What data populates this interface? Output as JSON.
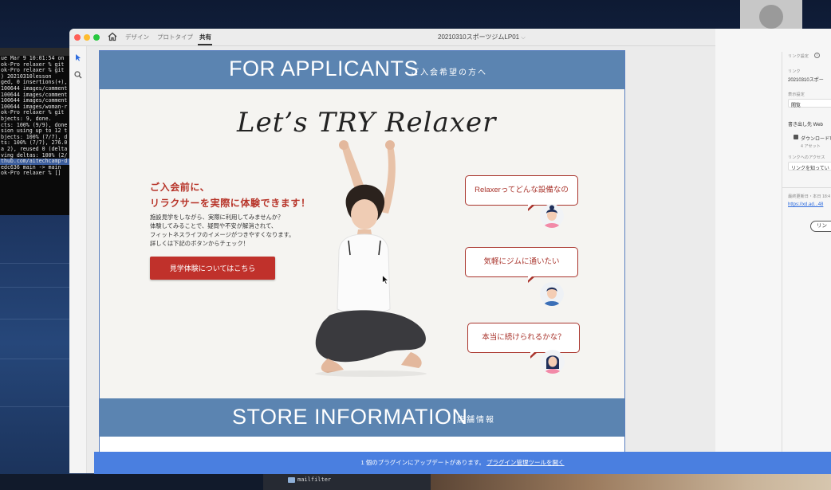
{
  "terminal": {
    "lines": [
      "ue Mar  9 10:01:54 on",
      "ok-Pro relaxer % git",
      "ok-Pro relaxer % git",
      ") 20210310lesson",
      "ged, 0 insertions(+),",
      "100644 images/comment",
      "100644 images/comment",
      "100644 images/comment",
      "100644 images/woman-r",
      "ok-Pro relaxer % git",
      "bjects: 9, done.",
      "cts: 100% (9/9), done",
      "sion using up to 12 t",
      "bjects: 100% (7/7), d",
      "ts: 100% (7/7), 276.0",
      "a 2), reused 0 (delta",
      "ving deltas: 100% (2/",
      "thub.com/aitechcamp-d",
      "edc636  main -> main",
      "ok-Pro relaxer % []"
    ]
  },
  "app": {
    "tabs": [
      "デザイン",
      "プロトタイプ",
      "共有"
    ],
    "doc_title": "20210310スポーツジムLP01",
    "accent": "#5b84b1"
  },
  "artboard": {
    "top_banner": {
      "title": "FOR APPLICANTS",
      "subtitle": "ご入会希望の方へ"
    },
    "script_title": "Let’s TRY Relaxer",
    "heading_line1": "ご入会前に、",
    "heading_line2": "リラクサーを実際に体験できます！",
    "body_lines": [
      "施設見学をしながら、実際に利用してみませんか？",
      "体験してみることで、疑問や不安が解消されて、",
      "フィットネスライフのイメージがつきやすくなります。",
      "詳しくは下記のボタンからチェック！"
    ],
    "cta_label": "見学体験についてはこちら",
    "bubbles": [
      "Relaxerってどんな設備なの",
      "気軽にジムに通いたい",
      "本当に続けられるかな？"
    ],
    "bottom_banner": {
      "title": "STORE INFORMATION",
      "subtitle": "店舗情報"
    }
  },
  "right_panel": {
    "link_settings": "リンク設定",
    "link_label": "リンク",
    "link_value": "20210310スポー",
    "view_label": "表示設定",
    "view_value": "閲覧",
    "export_label": "書き出し先 Web",
    "download_label": "ダウンロード可",
    "assets_label": "4 アセット",
    "access_label": "リンクへのアクセス",
    "access_value": "リンクを知ってい",
    "updated_label": "最終更新日・本日 18:4",
    "url": "https://xd.ad...48",
    "link_button": "リン"
  },
  "notification": {
    "text": "1 個のプラグインにアップデートがあります。",
    "link": "プラグイン管理ツールを開く"
  },
  "dock": {
    "folder_label": "mailfilter"
  }
}
